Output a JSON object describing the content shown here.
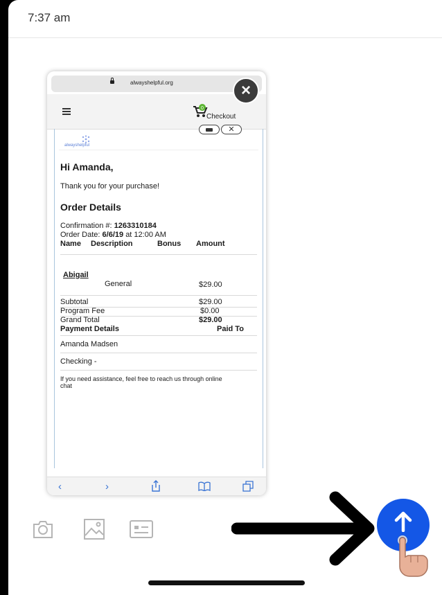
{
  "status_bar": {
    "time": "7:37 am"
  },
  "preview": {
    "url": "alwayshelpful.org",
    "nav": {
      "checkout_label": "Checkout",
      "cart_badge": "0"
    },
    "email": {
      "logo_text": "alwayshelpful",
      "greeting": "Hi Amanda,",
      "thanks": "Thank you for your purchase!",
      "order_title": "Order Details",
      "confirmation_label": "Confirmation #:",
      "confirmation_number": "1263310184",
      "order_date_label": "Order Date:",
      "order_date": "6/6/19",
      "order_time": "at 12:00 AM",
      "columns": [
        "Name",
        "Description",
        "Bonus",
        "Amount"
      ],
      "item": {
        "name": "Abigail",
        "description": "General",
        "amount": "$29.00"
      },
      "totals": {
        "subtotal_label": "Subtotal",
        "subtotal": "$29.00",
        "fee_label": "Program Fee",
        "fee": "$0.00",
        "grand_label": "Grand Total",
        "grand": "$29.00"
      },
      "payment_label": "Payment Details",
      "paid_to_label": "Paid To",
      "payer": "Amanda Madsen",
      "method": "Checking -",
      "assistance": "If you need assistance, feel free to reach us through online",
      "assistance_2": "chat"
    }
  },
  "accent_color": "#1457e6",
  "toolbar_icons": [
    "camera-icon",
    "image-icon",
    "id-card-icon"
  ],
  "send_icon": "arrow-up-icon"
}
